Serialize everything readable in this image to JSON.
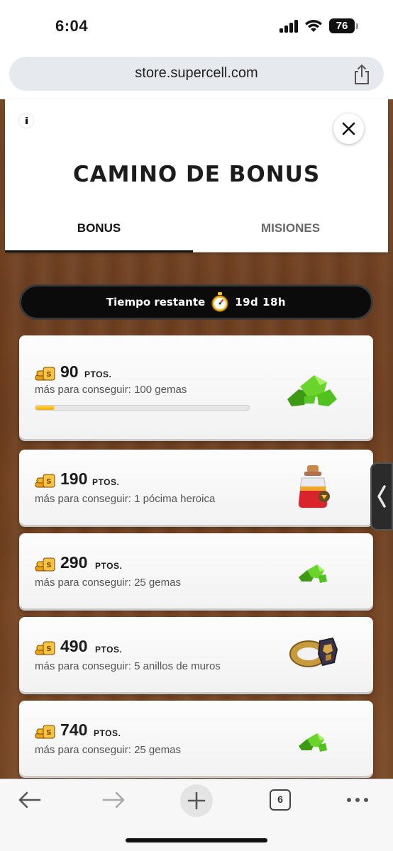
{
  "status_bar": {
    "time": "6:04",
    "battery": "76"
  },
  "browser": {
    "url": "store.supercell.com",
    "tab_count": "6"
  },
  "header": {
    "title": "CAMINO DE BONUS",
    "tabs": [
      {
        "label": "BONUS",
        "active": true
      },
      {
        "label": "MISIONES",
        "active": false
      }
    ]
  },
  "timer": {
    "label": "Tiempo restante",
    "value": "19d 18h"
  },
  "rewards": [
    {
      "points": "90",
      "unit": "PTOS.",
      "description": "más para conseguir: 100 gemas",
      "icon": "gems-pile-icon",
      "progress": 0.09
    },
    {
      "points": "190",
      "unit": "PTOS.",
      "description": "más para conseguir: 1 pócima heroica",
      "icon": "hero-potion-icon"
    },
    {
      "points": "290",
      "unit": "PTOS.",
      "description": "más para conseguir: 25 gemas",
      "icon": "gems-icon"
    },
    {
      "points": "490",
      "unit": "PTOS.",
      "description": "más para conseguir: 5 anillos de muros",
      "icon": "wall-ring-icon"
    },
    {
      "points": "740",
      "unit": "PTOS.",
      "description": "más para conseguir: 25 gemas",
      "icon": "gems-icon"
    }
  ],
  "colors": {
    "progress": "#f6a800",
    "wood": "#7a4a28",
    "gem": "#4fc21e"
  }
}
